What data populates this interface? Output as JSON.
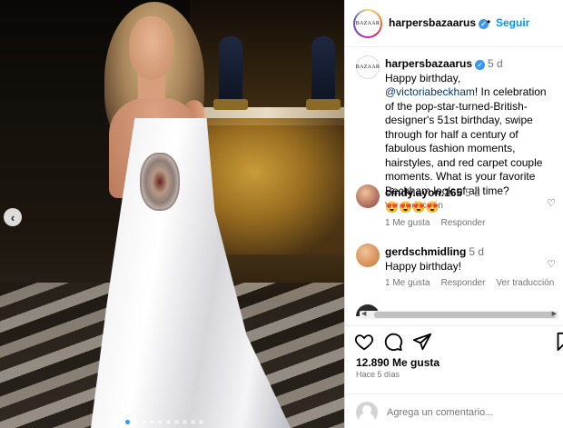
{
  "post": {
    "image_alt": "Victoria Beckham in a white gown on a runway",
    "slide_count": 10,
    "active_slide": 1
  },
  "header": {
    "avatar_text": "BAZAAR",
    "username": "harpersbazaarus",
    "verified": true,
    "separator": "•",
    "follow_label": "Seguir"
  },
  "caption": {
    "avatar_text": "BAZAAR",
    "username": "harpersbazaarus",
    "time": "5 d",
    "text_before": "Happy birthday, ",
    "mention": "@victoriabeckham",
    "text_after": "! In celebration of the pop-star-turned-British-designer's 51st birthday, swipe through for half a century of fabulous fashion moments, hairstyles, and red carpet couple moments. What is your favorite Beckham look of all time?",
    "translate_label": "Ver traducción"
  },
  "comments": [
    {
      "username": "cindy.ayon.165",
      "time": "5 d",
      "text": "😍😍😍😍",
      "likes_label": "1 Me gusta",
      "reply_label": "Responder",
      "translate_label": "",
      "avatar_color": "#8b3a3a"
    },
    {
      "username": "gerdschmidling",
      "time": "5 d",
      "text": "Happy birthday!",
      "likes_label": "1 Me gusta",
      "reply_label": "Responder",
      "translate_label": "Ver traducción",
      "avatar_color": "#c9722e"
    }
  ],
  "actions": {
    "like_icon": "heart-outline",
    "comment_icon": "comment-bubble",
    "share_icon": "paper-plane",
    "save_icon": "bookmark"
  },
  "stats": {
    "likes": "12.890 Me gusta",
    "posted": "Hace 5 días"
  },
  "composer": {
    "placeholder": "Agrega un comentario..."
  },
  "colors": {
    "link_blue": "#0095f6",
    "mention_blue": "#00376b",
    "muted_gray": "#737373",
    "verified_blue": "#3897f0"
  }
}
